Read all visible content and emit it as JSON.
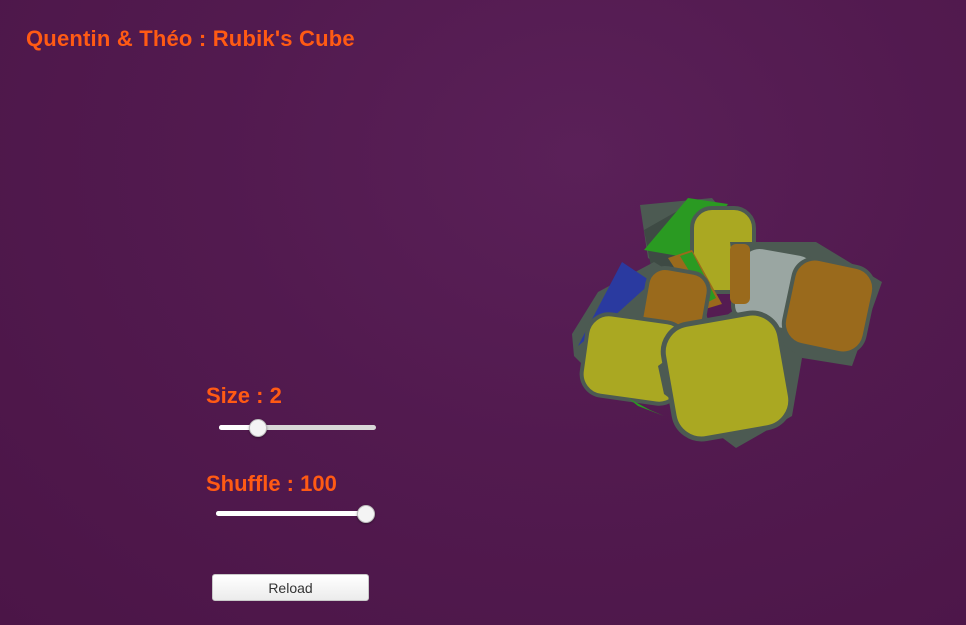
{
  "app": {
    "title": "Quentin & Théo : Rubik's Cube"
  },
  "controls": {
    "size": {
      "label": "Size : 2",
      "value": 2,
      "position": 0.24
    },
    "shuffle": {
      "label": "Shuffle : 100",
      "value": 100,
      "position": 1.0
    },
    "reload_label": "Reload"
  },
  "colors": {
    "background": "#521a4f",
    "accent_text": "#ff5a14",
    "cube_green": "#2a9a22",
    "cube_yellow": "#aaa822",
    "cube_orange": "#9a6a1c",
    "cube_blue": "#2a3aa0",
    "cube_white": "#9aa6a2",
    "cube_body": "#4c5a52"
  }
}
